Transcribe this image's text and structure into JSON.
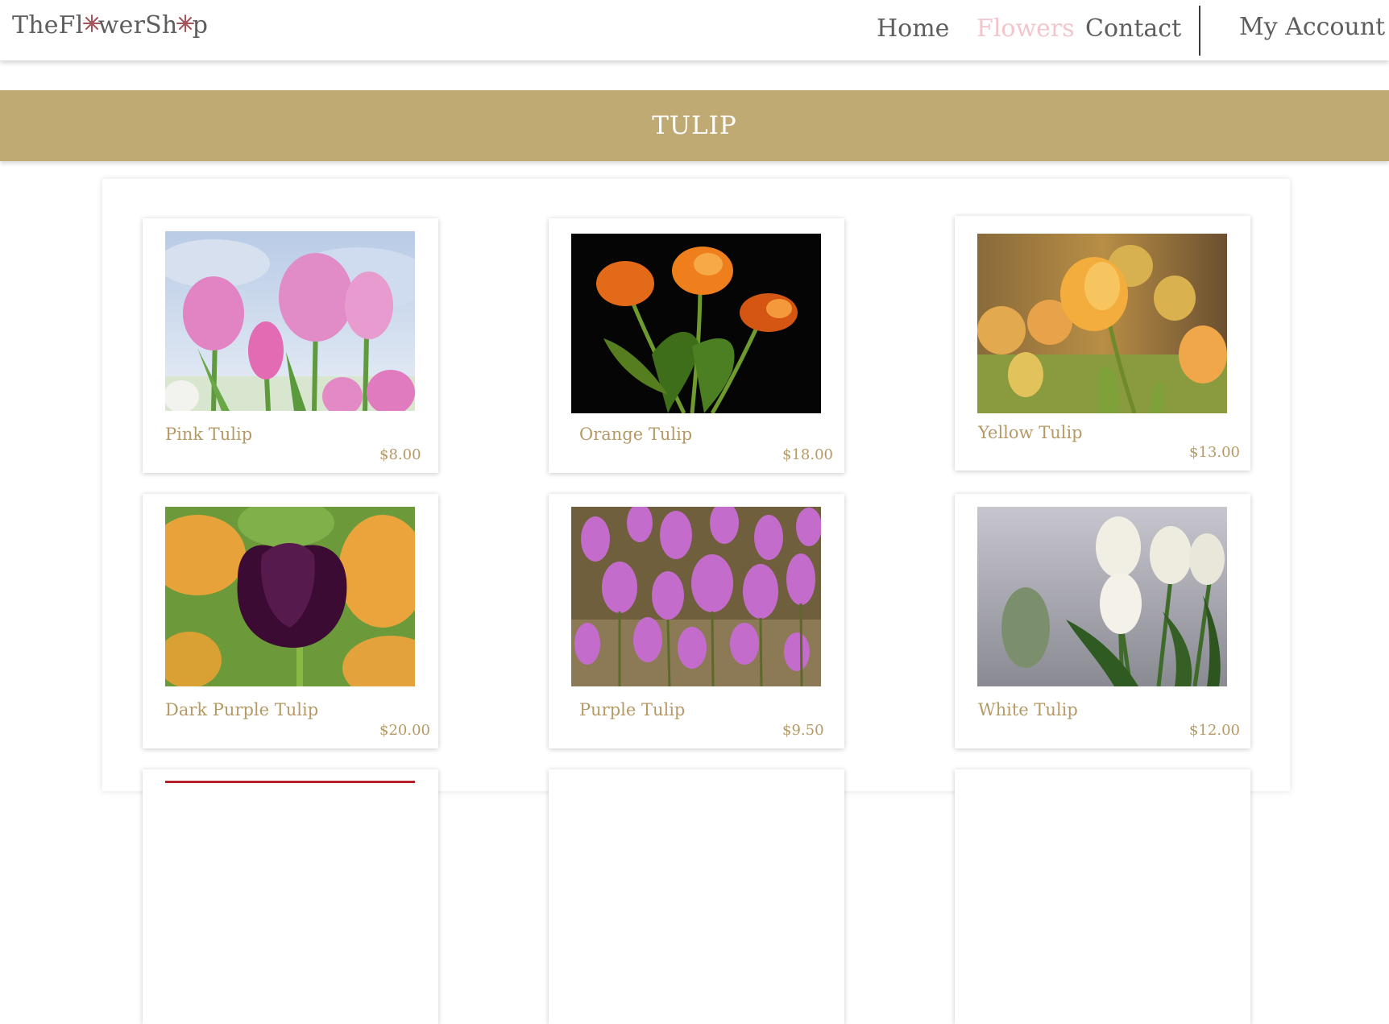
{
  "header": {
    "logo": {
      "before": "TheFl",
      "o": "o",
      "middle": "werSh",
      "o2": "o",
      "after": "p"
    },
    "nav": {
      "home": "Home",
      "flowers": "Flowers",
      "contact": "Contact",
      "account": "My Account"
    },
    "active_item": "Flowers",
    "active_color": "#f2c6cc"
  },
  "banner": {
    "title": "TULIP",
    "color": "#c0aa74"
  },
  "products": [
    {
      "name": "Pink Tulip",
      "price": "$8.00"
    },
    {
      "name": "Orange Tulip",
      "price": "$18.00"
    },
    {
      "name": "Yellow Tulip",
      "price": "$13.00"
    },
    {
      "name": "Dark Purple Tulip",
      "price": "$20.00"
    },
    {
      "name": "Purple Tulip",
      "price": "$9.50"
    },
    {
      "name": "White Tulip",
      "price": "$12.00"
    }
  ],
  "colors": {
    "accent_gold": "#b59a66",
    "nav_text": "#5e5e5e"
  },
  "icons": {
    "logo_flower": "flower-icon"
  }
}
